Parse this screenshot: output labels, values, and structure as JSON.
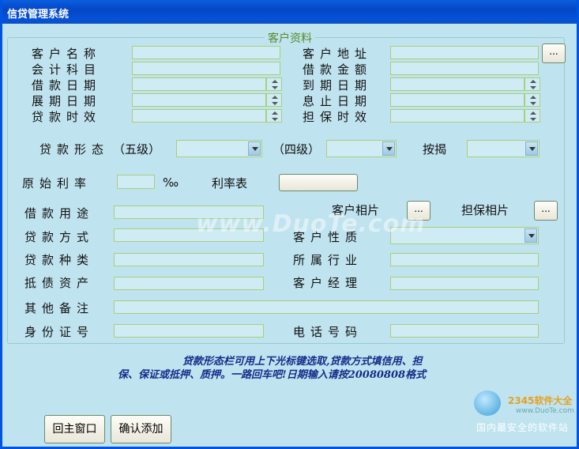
{
  "window": {
    "title": "信贷管理系统"
  },
  "group": {
    "title": "客户资料"
  },
  "labels": {
    "customer_name": "客户名称",
    "customer_address": "客户地址",
    "account_subject": "会计科目",
    "loan_amount": "借款金额",
    "loan_date": "借款日期",
    "due_date": "到期日期",
    "extension_date": "展期日期",
    "interest_stop_date": "息止日期",
    "loan_validity": "贷款时效",
    "guarantee_validity": "担保时效",
    "loan_form": "贷款形态",
    "five_level": "（五级）",
    "four_level": "（四级）",
    "pledge": "按揭",
    "original_rate": "原始利率",
    "permille": "‰",
    "rate_table": "利率表",
    "loan_purpose": "借款用途",
    "customer_photo": "客户相片",
    "guarantee_photo": "担保相片",
    "loan_method": "贷款方式",
    "customer_nature": "客户性质",
    "loan_type": "贷款种类",
    "industry": "所属行业",
    "collateral": "抵债资产",
    "customer_manager": "客户经理",
    "other_notes": "其他备注",
    "id_number": "身份证号",
    "phone_number": "电话号码"
  },
  "buttons": {
    "browse": "...",
    "rate_table_value": "",
    "back_main": "回主窗口",
    "confirm_add": "确认添加"
  },
  "hint": {
    "line1": "贷款形态栏可用上下光标键选取,贷款方式填信用、担",
    "line2": "保、保证或抵押、质押。一路回车吧!日期输入请按20080808格式"
  },
  "watermark": {
    "text": "www.DuoTe.com"
  },
  "logo": {
    "brand": "2345软件大全",
    "url": "www.DuoTe.com",
    "slogan": "国内最安全的软件站"
  }
}
